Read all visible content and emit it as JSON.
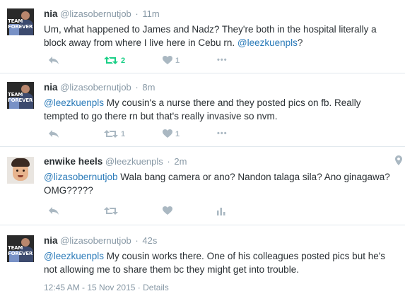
{
  "tweets": [
    {
      "name": "nia",
      "handle": "@lizasobernutjob",
      "time": "11m",
      "text_before": "Um, what happened to James and Nadz? They're both in the hospital literally a block away from where I live here in Cebu rn. ",
      "text_mention": "@leezkuenpls",
      "text_after": "?",
      "avatar_text": "TEAM FOREVER",
      "retweet_count": "2",
      "like_count": "1"
    },
    {
      "name": "nia",
      "handle": "@lizasobernutjob",
      "time": "8m",
      "text_mention": "@leezkuenpls",
      "text_after": " My cousin's a nurse there and they posted pics on fb. Really tempted to go there rn but that's really invasive so nvm.",
      "avatar_text": "TEAM FOREVER",
      "retweet_count": "1",
      "like_count": "1"
    },
    {
      "name": "enwike heels",
      "handle": "@leezkuenpls",
      "time": "2m",
      "text_mention": "@lizasobernutjob",
      "text_after": " Wala bang camera or ano? Nandon talaga sila? Ano ginagawa? OMG?????"
    },
    {
      "name": "nia",
      "handle": "@lizasobernutjob",
      "time": "42s",
      "text_mention": "@leezkuenpls",
      "text_after": " My cousin works there. One of his colleagues posted pics but he's not allowing me to share them bc they might get into trouble.",
      "avatar_text": "TEAM FOREVER",
      "timestamp": "12:45 AM - 15 Nov 2015",
      "details": "Details"
    }
  ],
  "separator": "·",
  "more_label": "•••",
  "colors": {
    "mention": "#2b7bb9",
    "retweet_active": "#19cf86",
    "muted": "#8899a6",
    "icon": "#aab8c2"
  },
  "icons": [
    "reply-icon",
    "retweet-icon",
    "like-icon",
    "more-icon",
    "analytics-icon",
    "location-pin-icon"
  ]
}
